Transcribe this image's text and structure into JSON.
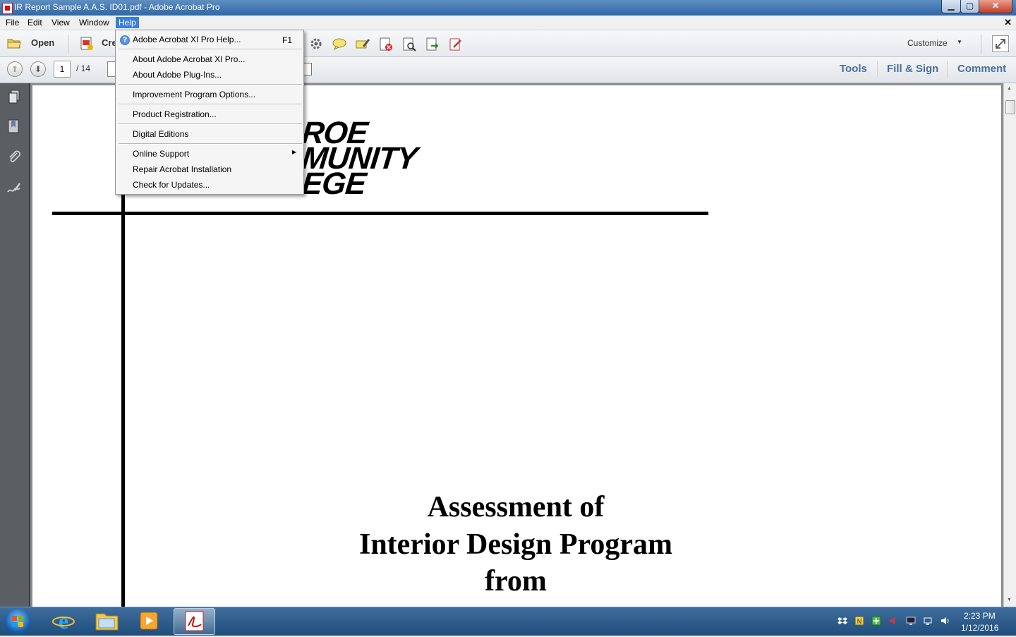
{
  "window": {
    "title": "IR Report Sample A.A.S. ID01.pdf - Adobe Acrobat Pro",
    "min_label": "▁",
    "max_label": "▢",
    "close_label": "✕"
  },
  "menubar": {
    "items": [
      "File",
      "Edit",
      "View",
      "Window",
      "Help"
    ],
    "active": "Help",
    "close_label": "✕"
  },
  "toolbar": {
    "open_label": "Open",
    "create_label": "Cre",
    "customize_label": "Customize"
  },
  "navbar": {
    "page_current": "1",
    "page_total": "/ 14",
    "panes": [
      "Tools",
      "Fill & Sign",
      "Comment"
    ]
  },
  "help_menu": {
    "items": [
      {
        "label": "Adobe Acrobat XI Pro Help...",
        "shortcut": "F1"
      },
      {
        "label": "About Adobe Acrobat XI Pro..."
      },
      {
        "label": "About Adobe Plug-Ins..."
      },
      {
        "label": "Improvement Program Options..."
      },
      {
        "label": "Product Registration..."
      },
      {
        "label": "Digital Editions"
      },
      {
        "label": "Online Support",
        "submenu": true
      },
      {
        "label": "Repair Acrobat Installation"
      },
      {
        "label": "Check for Updates..."
      }
    ],
    "submenu_arrow": "▶"
  },
  "document": {
    "logo_lines": [
      "ROE",
      "MUNITY",
      "EGE"
    ],
    "heading_lines": [
      "Assessment of",
      "Interior Design Program",
      "from"
    ]
  },
  "taskbar": {
    "time": "2:23 PM",
    "date": "1/12/2016"
  }
}
